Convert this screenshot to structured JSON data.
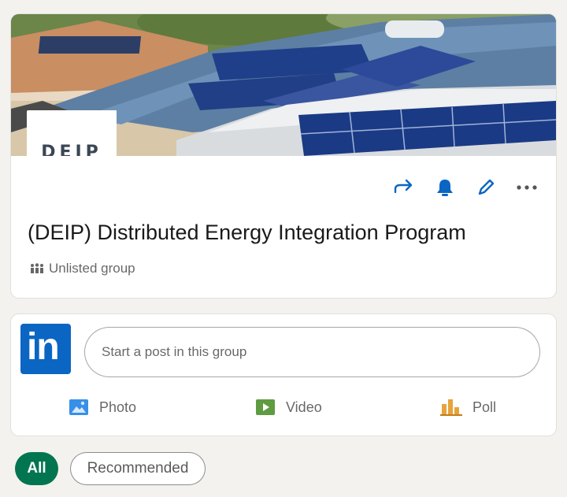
{
  "group": {
    "logo_text": "DEIP",
    "title": "(DEIP) Distributed Energy Integration Program",
    "type": "Unlisted group",
    "actions": [
      "share-icon",
      "bell-icon",
      "pencil-icon",
      "more-icon"
    ]
  },
  "composer": {
    "logo": "in",
    "placeholder": "Start a post in this group",
    "actions": {
      "photo": "Photo",
      "video": "Video",
      "poll": "Poll"
    }
  },
  "filters": {
    "all": "All",
    "recommended": "Recommended",
    "active": "All"
  },
  "colors": {
    "accent_blue": "#0a66c2",
    "active_pill": "#01754f",
    "photo": "#378fe9",
    "video": "#5f9b41",
    "poll": "#e7a33e"
  }
}
